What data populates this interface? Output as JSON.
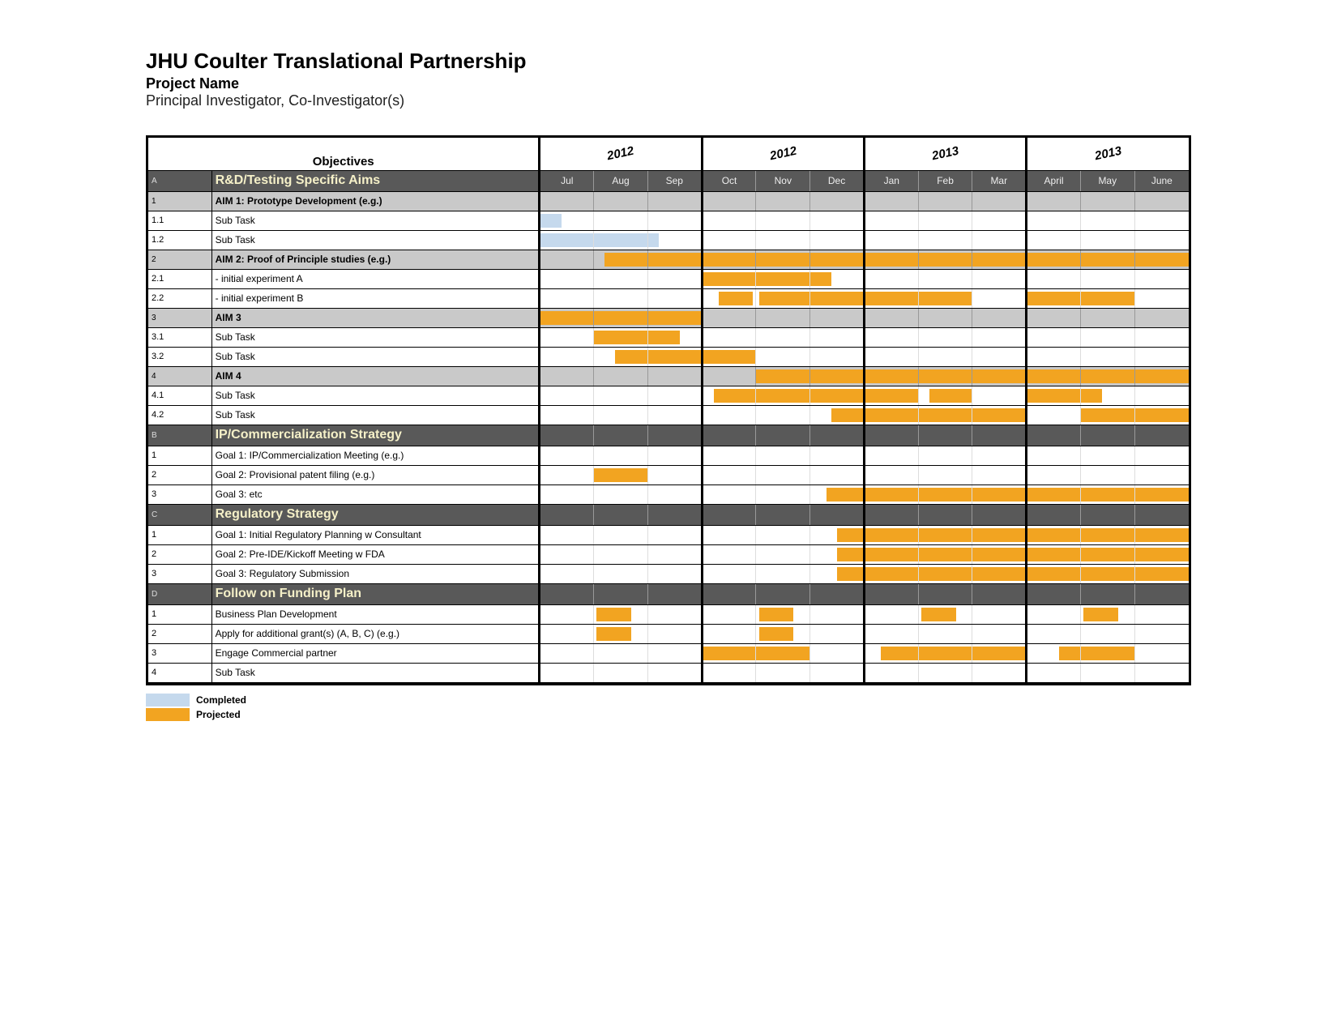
{
  "header": {
    "title": "JHU Coulter Translational Partnership",
    "subtitle": "Project Name",
    "byline": "Principal Investigator, Co-Investigator(s)",
    "objectives_heading": "Objectives"
  },
  "quarters": [
    {
      "year": "2012",
      "months": [
        "Jul",
        "Aug",
        "Sep"
      ]
    },
    {
      "year": "2012",
      "months": [
        "Oct",
        "Nov",
        "Dec"
      ]
    },
    {
      "year": "2013",
      "months": [
        "Jan",
        "Feb",
        "Mar"
      ]
    },
    {
      "year": "2013",
      "months": [
        "April",
        "May",
        "June"
      ]
    }
  ],
  "legend": {
    "completed": "Completed",
    "projected": "Projected"
  },
  "colors": {
    "completed": "#c5d9ed",
    "projected": "#f2a421",
    "section_bg": "#595959",
    "aim_bg": "#c9c9c9"
  },
  "chart_data": {
    "type": "gantt",
    "time_axis": {
      "unit": "month",
      "start": "2012-07",
      "end": "2013-06",
      "labels": [
        "Jul",
        "Aug",
        "Sep",
        "Oct",
        "Nov",
        "Dec",
        "Jan",
        "Feb",
        "Mar",
        "April",
        "May",
        "June"
      ]
    },
    "sections": [
      {
        "letter": "A",
        "title": "R&D/Testing Specific Aims",
        "show_month_headers": true,
        "rows": [
          {
            "type": "aim",
            "num": "1",
            "label": "AIM 1: Prototype Development (e.g.)",
            "bars": []
          },
          {
            "type": "task",
            "num": "1.1",
            "label": "Sub Task",
            "bars": [
              {
                "status": "completed",
                "start": 0.0,
                "end": 0.4
              }
            ]
          },
          {
            "type": "task",
            "num": "1.2",
            "label": "Sub Task",
            "bars": [
              {
                "status": "completed",
                "start": 0.0,
                "end": 2.2
              }
            ]
          },
          {
            "type": "aim",
            "num": "2",
            "label": "AIM 2: Proof of Principle studies (e.g.)",
            "bars": [
              {
                "status": "projected",
                "start": 1.2,
                "end": 12.0
              }
            ]
          },
          {
            "type": "task",
            "num": "2.1",
            "label": " - initial experiment A",
            "bars": [
              {
                "status": "projected",
                "start": 3.0,
                "end": 5.4
              }
            ]
          },
          {
            "type": "task",
            "num": "2.2",
            "label": " - initial experiment B",
            "bars": [
              {
                "status": "projected",
                "start": 3.3,
                "end": 3.95
              },
              {
                "status": "projected",
                "start": 4.05,
                "end": 8.0
              },
              {
                "status": "projected",
                "start": 9.0,
                "end": 11.0
              }
            ]
          },
          {
            "type": "aim",
            "num": "3",
            "label": "AIM 3",
            "bars": [
              {
                "status": "projected",
                "start": 0.0,
                "end": 3.0
              }
            ]
          },
          {
            "type": "task",
            "num": "3.1",
            "label": "Sub Task",
            "bars": [
              {
                "status": "projected",
                "start": 1.0,
                "end": 2.6
              }
            ]
          },
          {
            "type": "task",
            "num": "3.2",
            "label": "Sub Task",
            "bars": [
              {
                "status": "projected",
                "start": 1.4,
                "end": 4.0
              }
            ]
          },
          {
            "type": "aim",
            "num": "4",
            "label": "AIM 4",
            "bars": [
              {
                "status": "projected",
                "start": 4.0,
                "end": 12.0
              }
            ]
          },
          {
            "type": "task",
            "num": "4.1",
            "label": "Sub Task",
            "bars": [
              {
                "status": "projected",
                "start": 3.2,
                "end": 7.0
              },
              {
                "status": "projected",
                "start": 7.2,
                "end": 8.0
              },
              {
                "status": "projected",
                "start": 9.0,
                "end": 10.4
              }
            ]
          },
          {
            "type": "task",
            "num": "4.2",
            "label": "Sub Task",
            "bars": [
              {
                "status": "projected",
                "start": 5.4,
                "end": 9.0
              },
              {
                "status": "projected",
                "start": 10.0,
                "end": 12.0
              }
            ]
          }
        ]
      },
      {
        "letter": "B",
        "title": "IP/Commercialization Strategy",
        "rows": [
          {
            "type": "task",
            "num": "1",
            "label": "Goal 1: IP/Commercialization Meeting (e.g.)",
            "bars": []
          },
          {
            "type": "task",
            "num": "2",
            "label": "Goal 2: Provisional patent filing (e.g.)",
            "bars": [
              {
                "status": "projected",
                "start": 1.0,
                "end": 2.0
              }
            ]
          },
          {
            "type": "task",
            "num": "3",
            "label": "Goal 3: etc",
            "bars": [
              {
                "status": "projected",
                "start": 5.3,
                "end": 12.0
              }
            ]
          }
        ]
      },
      {
        "letter": "C",
        "title": "Regulatory Strategy",
        "rows": [
          {
            "type": "task",
            "num": "1",
            "label": "Goal 1: Initial Regulatory Planning w Consultant",
            "bars": [
              {
                "status": "projected",
                "start": 5.5,
                "end": 12.0
              }
            ]
          },
          {
            "type": "task",
            "num": "2",
            "label": "Goal 2: Pre-IDE/Kickoff Meeting w FDA",
            "bars": [
              {
                "status": "projected",
                "start": 5.5,
                "end": 12.0
              }
            ]
          },
          {
            "type": "task",
            "num": "3",
            "label": "Goal 3: Regulatory Submission",
            "bars": [
              {
                "status": "projected",
                "start": 5.5,
                "end": 12.0
              }
            ]
          }
        ]
      },
      {
        "letter": "D",
        "title": "Follow on Funding Plan",
        "rows": [
          {
            "type": "task",
            "num": "1",
            "label": "Business Plan Development",
            "bars": [
              {
                "status": "projected",
                "start": 1.05,
                "end": 1.7
              },
              {
                "status": "projected",
                "start": 4.05,
                "end": 4.7
              },
              {
                "status": "projected",
                "start": 7.05,
                "end": 7.7
              },
              {
                "status": "projected",
                "start": 10.05,
                "end": 10.7
              }
            ]
          },
          {
            "type": "task",
            "num": "2",
            "label": "Apply for additional grant(s) (A, B, C) (e.g.)",
            "bars": [
              {
                "status": "projected",
                "start": 1.05,
                "end": 1.7
              },
              {
                "status": "projected",
                "start": 4.05,
                "end": 4.7
              }
            ]
          },
          {
            "type": "task",
            "num": "3",
            "label": "Engage Commercial partner",
            "bars": [
              {
                "status": "projected",
                "start": 3.0,
                "end": 5.0
              },
              {
                "status": "projected",
                "start": 6.3,
                "end": 9.0
              },
              {
                "status": "projected",
                "start": 9.6,
                "end": 11.0
              }
            ]
          },
          {
            "type": "task",
            "num": "4",
            "label": "Sub Task",
            "bars": []
          }
        ]
      }
    ]
  }
}
